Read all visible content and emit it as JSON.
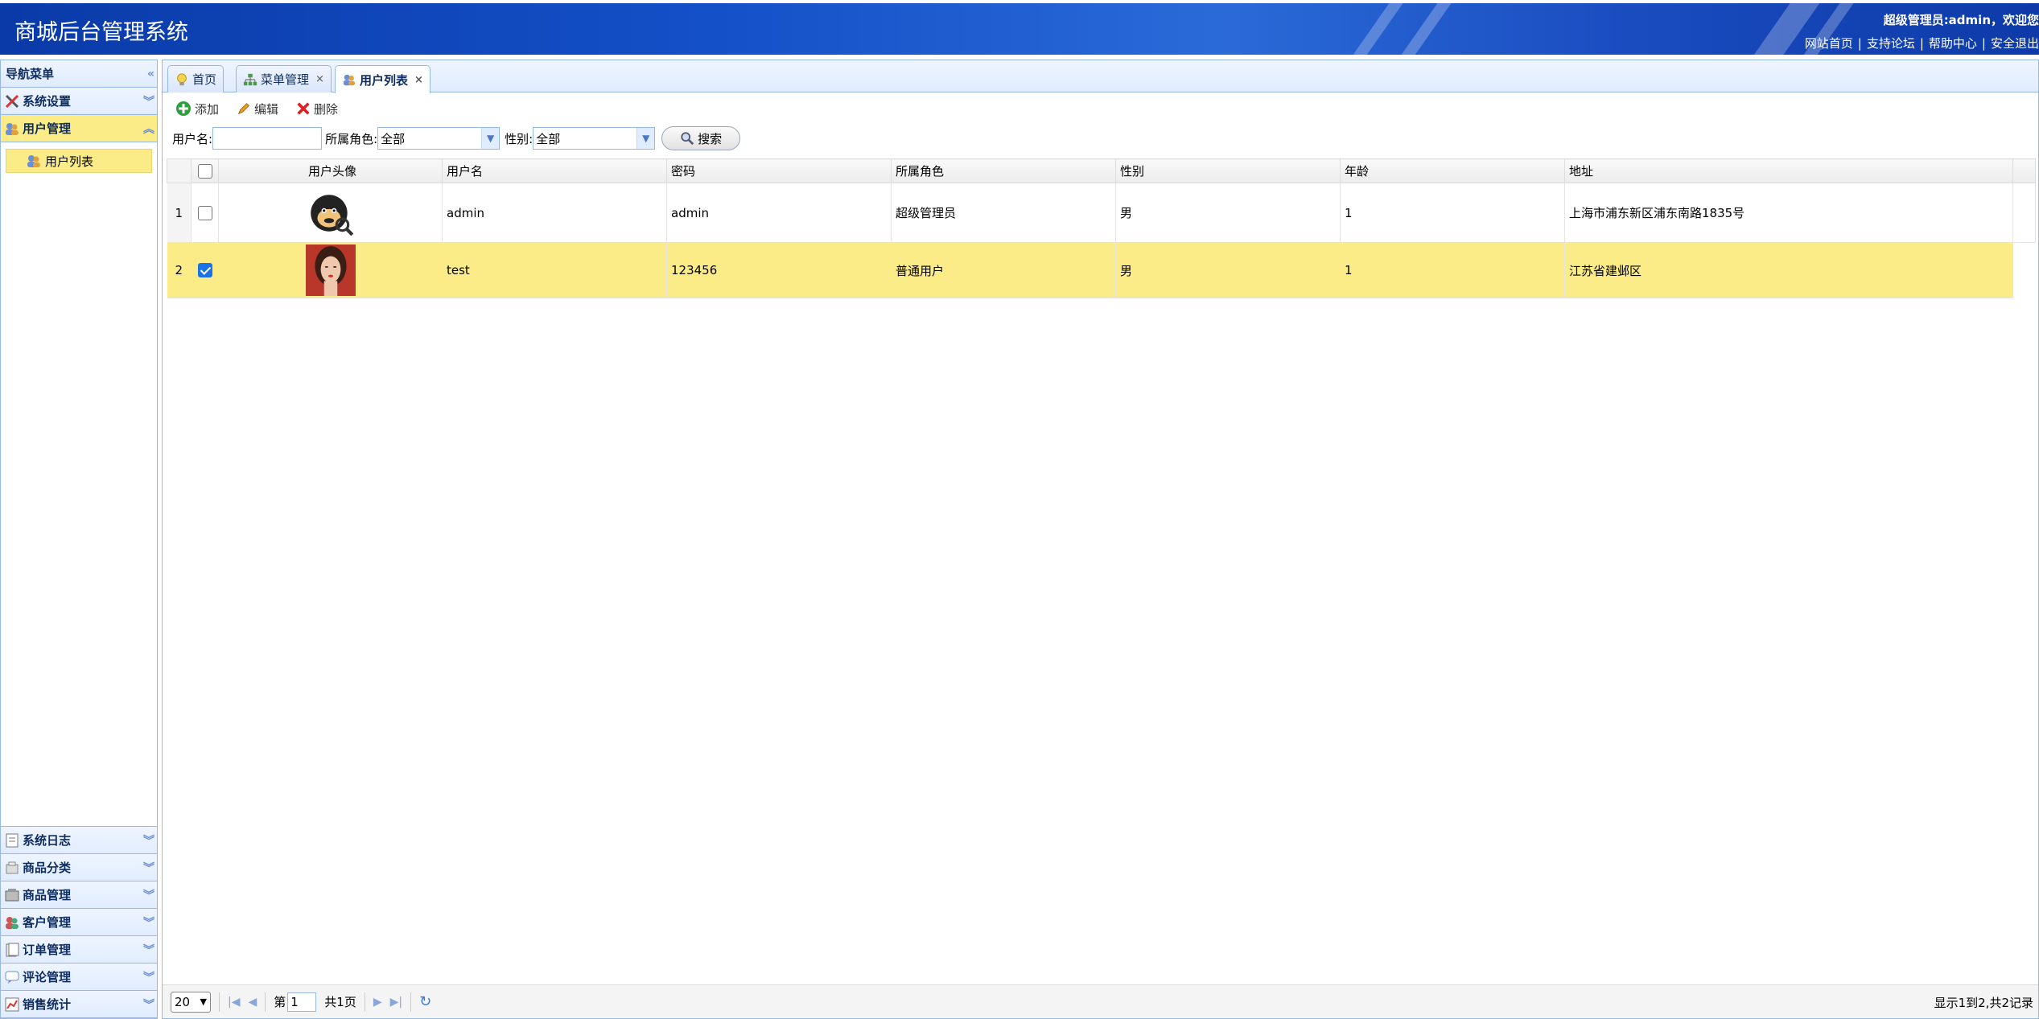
{
  "header": {
    "app_title": "商城后台管理系统",
    "welcome": "超级管理员:admin，欢迎您",
    "links": [
      "网站首页",
      "支持论坛",
      "帮助中心",
      "安全退出"
    ]
  },
  "sidebar": {
    "title": "导航菜单",
    "top_items": [
      {
        "label": "系统设置",
        "icon": "tools-icon"
      },
      {
        "label": "用户管理",
        "icon": "users-icon"
      }
    ],
    "sub_item": {
      "label": "用户列表",
      "icon": "users-icon"
    },
    "bottom_items": [
      {
        "label": "系统日志",
        "icon": "log-icon"
      },
      {
        "label": "商品分类",
        "icon": "category-icon"
      },
      {
        "label": "商品管理",
        "icon": "goods-icon"
      },
      {
        "label": "客户管理",
        "icon": "customer-icon"
      },
      {
        "label": "订单管理",
        "icon": "order-icon"
      },
      {
        "label": "评论管理",
        "icon": "comment-icon"
      },
      {
        "label": "销售统计",
        "icon": "stats-icon"
      }
    ]
  },
  "tabs": [
    {
      "label": "首页",
      "icon": "bulb-icon",
      "closable": false
    },
    {
      "label": "菜单管理",
      "icon": "tree-icon",
      "closable": true
    },
    {
      "label": "用户列表",
      "icon": "users-icon",
      "closable": true,
      "active": true
    }
  ],
  "toolbar": {
    "add": "添加",
    "edit": "编辑",
    "delete": "删除"
  },
  "filters": {
    "username_label": "用户名:",
    "username_value": "",
    "role_label": "所属角色:",
    "role_value": "全部",
    "gender_label": "性别:",
    "gender_value": "全部",
    "search": "搜索"
  },
  "grid": {
    "columns": [
      "用户头像",
      "用户名",
      "密码",
      "所属角色",
      "性别",
      "年龄",
      "地址"
    ],
    "rows": [
      {
        "n": "1",
        "checked": false,
        "avatar": "gorilla-avatar",
        "username": "admin",
        "password": "admin",
        "role": "超级管理员",
        "gender": "男",
        "age": "1",
        "address": "上海市浦东新区浦东南路1835号"
      },
      {
        "n": "2",
        "checked": true,
        "avatar": "woman-avatar",
        "username": "test",
        "password": "123456",
        "role": "普通用户",
        "gender": "男",
        "age": "1",
        "address": "江苏省建邺区"
      }
    ]
  },
  "pager": {
    "page_size": "20",
    "page_prefix": "第",
    "page_value": "1",
    "page_total": "共1页",
    "info": "显示1到2,共2记录"
  },
  "colors": {
    "header_blue": "#1450c8",
    "highlight_yellow": "#fbec88",
    "border_blue": "#95b8e7"
  }
}
